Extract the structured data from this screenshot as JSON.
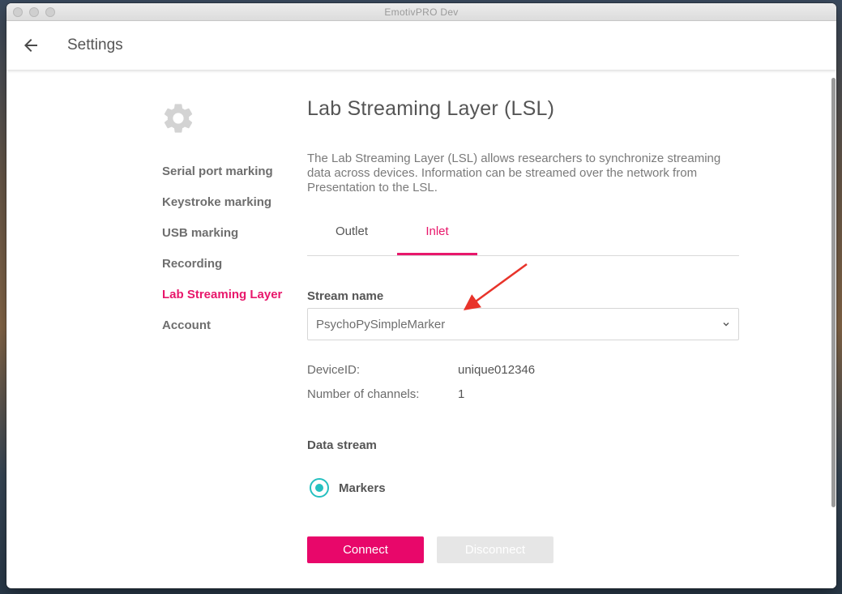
{
  "window": {
    "title": "EmotivPRO  Dev"
  },
  "appbar": {
    "title": "Settings",
    "back_icon": "arrow-left-icon"
  },
  "sidebar": {
    "icon": "gear-icon",
    "items": [
      {
        "label": "Serial port marking",
        "active": false
      },
      {
        "label": "Keystroke marking",
        "active": false
      },
      {
        "label": "USB marking",
        "active": false
      },
      {
        "label": "Recording",
        "active": false
      },
      {
        "label": "Lab Streaming Layer",
        "active": true
      },
      {
        "label": "Account",
        "active": false
      }
    ]
  },
  "main": {
    "title": "Lab Streaming Layer (LSL)",
    "description": "The Lab Streaming Layer (LSL) allows researchers to synchronize streaming data across devices. Information can be streamed over the network from Presentation to the LSL.",
    "tabs": [
      {
        "label": "Outlet",
        "active": false
      },
      {
        "label": "Inlet",
        "active": true
      }
    ],
    "stream_name_label": "Stream name",
    "stream_name_value": "PsychoPySimpleMarker",
    "device_id_label": "DeviceID:",
    "device_id_value": "unique012346",
    "channels_label": "Number of channels:",
    "channels_value": "1",
    "data_stream_label": "Data stream",
    "data_stream_option": "Markers",
    "connect_label": "Connect",
    "disconnect_label": "Disconnect"
  },
  "colors": {
    "accent": "#e8176b",
    "radio": "#25c0c0",
    "annotation_arrow": "#e8332a"
  }
}
